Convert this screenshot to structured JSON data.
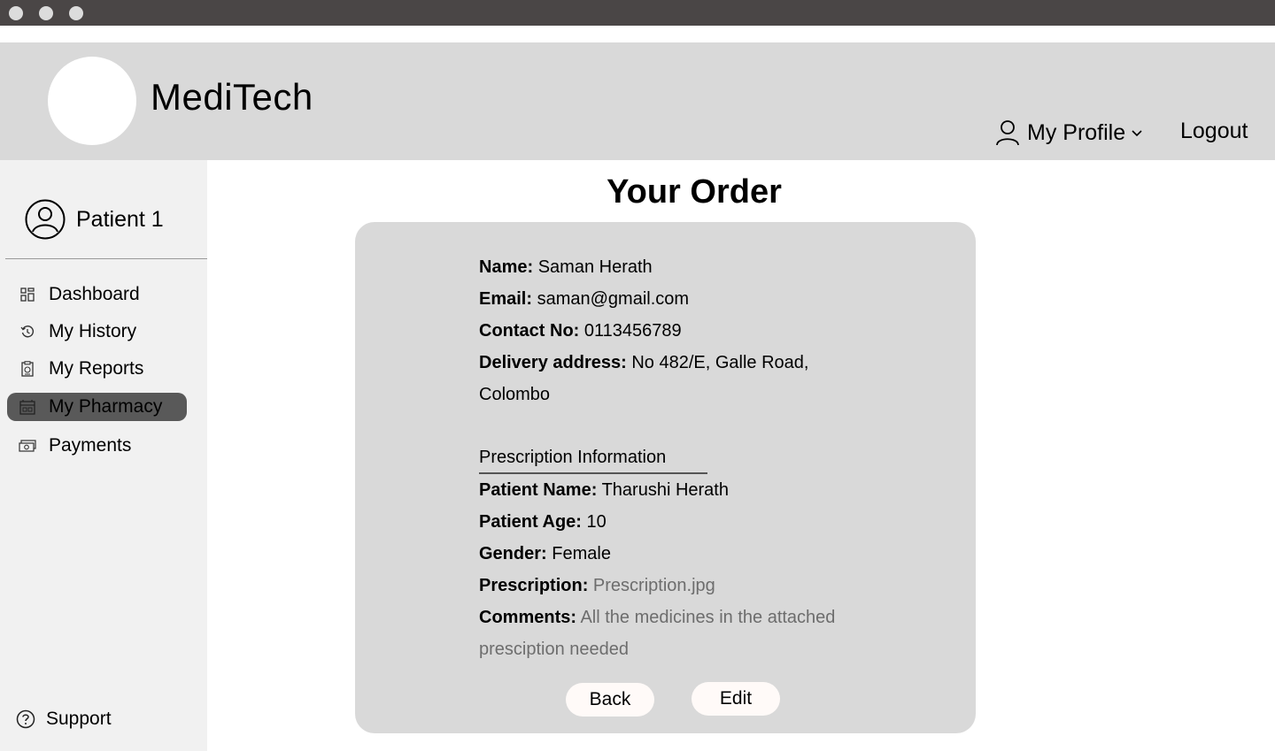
{
  "header": {
    "brand": "MediTech",
    "profile_label": "My Profile",
    "logout_label": "Logout"
  },
  "sidebar": {
    "user_name": "Patient 1",
    "items": [
      {
        "label": "Dashboard",
        "icon": "dashboard-grid-icon",
        "active": false
      },
      {
        "label": "My History",
        "icon": "history-icon",
        "active": false
      },
      {
        "label": "My Reports",
        "icon": "report-icon",
        "active": false
      },
      {
        "label": "My Pharmacy",
        "icon": "pharmacy-icon",
        "active": true
      },
      {
        "label": "Payments",
        "icon": "money-icon",
        "active": false
      }
    ],
    "support_label": "Support"
  },
  "main": {
    "title": "Your Order",
    "order": {
      "name_label": "Name:",
      "name": "Saman Herath",
      "email_label": "Email:",
      "email": "saman@gmail.com",
      "contact_label": "Contact No:",
      "contact": "0113456789",
      "address_label": "Delivery address:",
      "address_line1": "No 482/E, Galle Road,",
      "address_line2": "Colombo"
    },
    "prescription": {
      "section_title": "Prescription Information",
      "patient_name_label": "Patient Name:",
      "patient_name": "Tharushi Herath",
      "age_label": "Patient Age:",
      "age": "10",
      "gender_label": "Gender:",
      "gender": "Female",
      "file_label": "Prescription:",
      "file": "Prescription.jpg",
      "comments_label": "Comments:",
      "comments_line1": "All the medicines in the attached",
      "comments_line2": "presciption needed"
    },
    "buttons": {
      "back": "Back",
      "edit": "Edit"
    }
  },
  "colors": {
    "header_bg": "#d9d9d9",
    "sidebar_bg": "#f1f1f1",
    "active_nav": "#595959",
    "card_bg": "#d9d9d9",
    "titlebar": "#4a4646"
  }
}
